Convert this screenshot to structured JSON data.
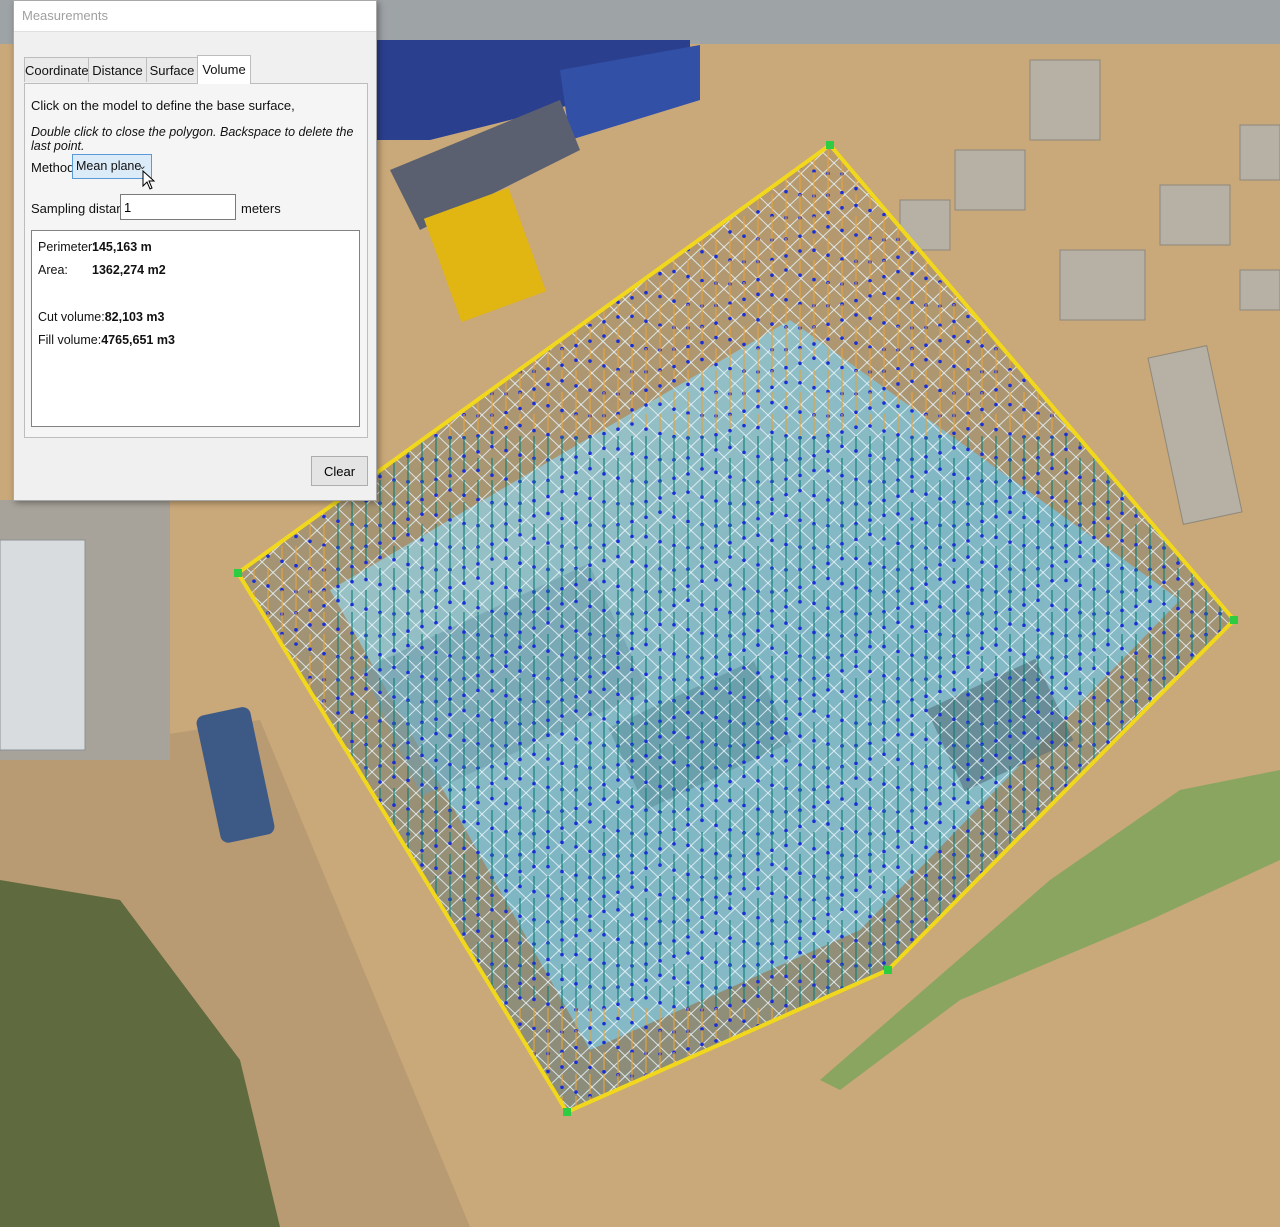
{
  "dialog": {
    "title": "Measurements",
    "tabs": [
      {
        "label": "Coordinate"
      },
      {
        "label": "Distance"
      },
      {
        "label": "Surface"
      },
      {
        "label": "Volume",
        "active": true
      }
    ],
    "hint_line1": "Click on the model to define the base surface,",
    "hint_line2": "Double click to close the polygon. Backspace to delete the last point.",
    "method_label": "Method:",
    "method_value": "Mean plane",
    "sampling_label": "Sampling distance:",
    "sampling_value": "1",
    "sampling_unit": "meters",
    "results": {
      "perimeter_label": "Perimeter:",
      "perimeter_value": "145,163 m",
      "area_label": "Area:",
      "area_value": "1362,274 m2",
      "cut_label": "Cut volume:",
      "cut_value": "82,103 m3",
      "fill_label": "Fill volume:",
      "fill_value": "4765,651 m3"
    },
    "clear_label": "Clear"
  },
  "icons": {
    "dropdown": "chevron-down-icon",
    "pointer": "mouse-cursor-icon"
  },
  "colors": {
    "polygon_outline": "#f2d81c",
    "vertex_marker": "#2ecc40",
    "grid_lines": "#e6f2f8",
    "sample_dots": "#1a2fd6",
    "fill_rods": "#0d7f7a",
    "cut_rods": "#e8a33a",
    "soil": "#c9a879",
    "pit_water": "#7fb6c4"
  }
}
